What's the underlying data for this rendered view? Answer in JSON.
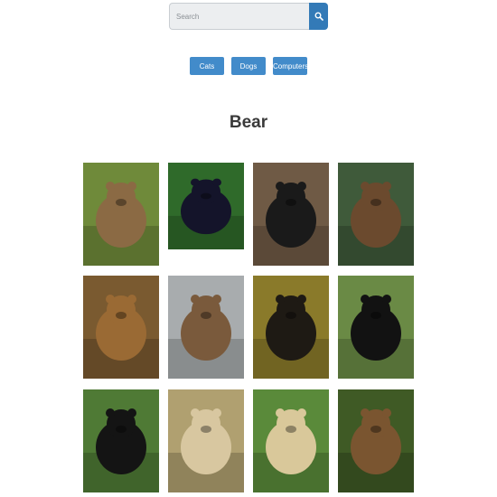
{
  "search": {
    "placeholder": "Search",
    "value": ""
  },
  "icons": {
    "search": "magnifier-icon"
  },
  "categories": [
    "Cats",
    "Dogs",
    "Computers"
  ],
  "title": "Bear",
  "colors": {
    "accent": "#337ab7",
    "button": "#428bca"
  },
  "gallery": [
    {
      "name": "brown-bear-standing-grass",
      "bg": "#6f8a3a",
      "bear": "#8b6a44"
    },
    {
      "name": "black-bear-forest",
      "bg": "#2f6a2a",
      "bear": "#14142a"
    },
    {
      "name": "black-bear-rocks",
      "bg": "#6f5a45",
      "bear": "#1a1a1a"
    },
    {
      "name": "grizzly-in-water",
      "bg": "#3f5a3a",
      "bear": "#6b4a2e"
    },
    {
      "name": "bear-face-closeup",
      "bg": "#7a5a30",
      "bear": "#9a6a34"
    },
    {
      "name": "grizzly-with-cub",
      "bg": "#a8acae",
      "bear": "#7a5a3c"
    },
    {
      "name": "spectacled-bear",
      "bg": "#8a7a2a",
      "bear": "#1e1a14"
    },
    {
      "name": "black-bears-meadow",
      "bg": "#6a8a45",
      "bear": "#121212"
    },
    {
      "name": "black-bear-hillside",
      "bg": "#4f7a35",
      "bear": "#141414"
    },
    {
      "name": "polar-bear-closeup",
      "bg": "#b0a070",
      "bear": "#d8c7a0"
    },
    {
      "name": "polar-bear-on-log",
      "bg": "#5a8a3a",
      "bear": "#d9c89a"
    },
    {
      "name": "brown-bear-portrait",
      "bg": "#3f5a25",
      "bear": "#7a5530"
    }
  ]
}
